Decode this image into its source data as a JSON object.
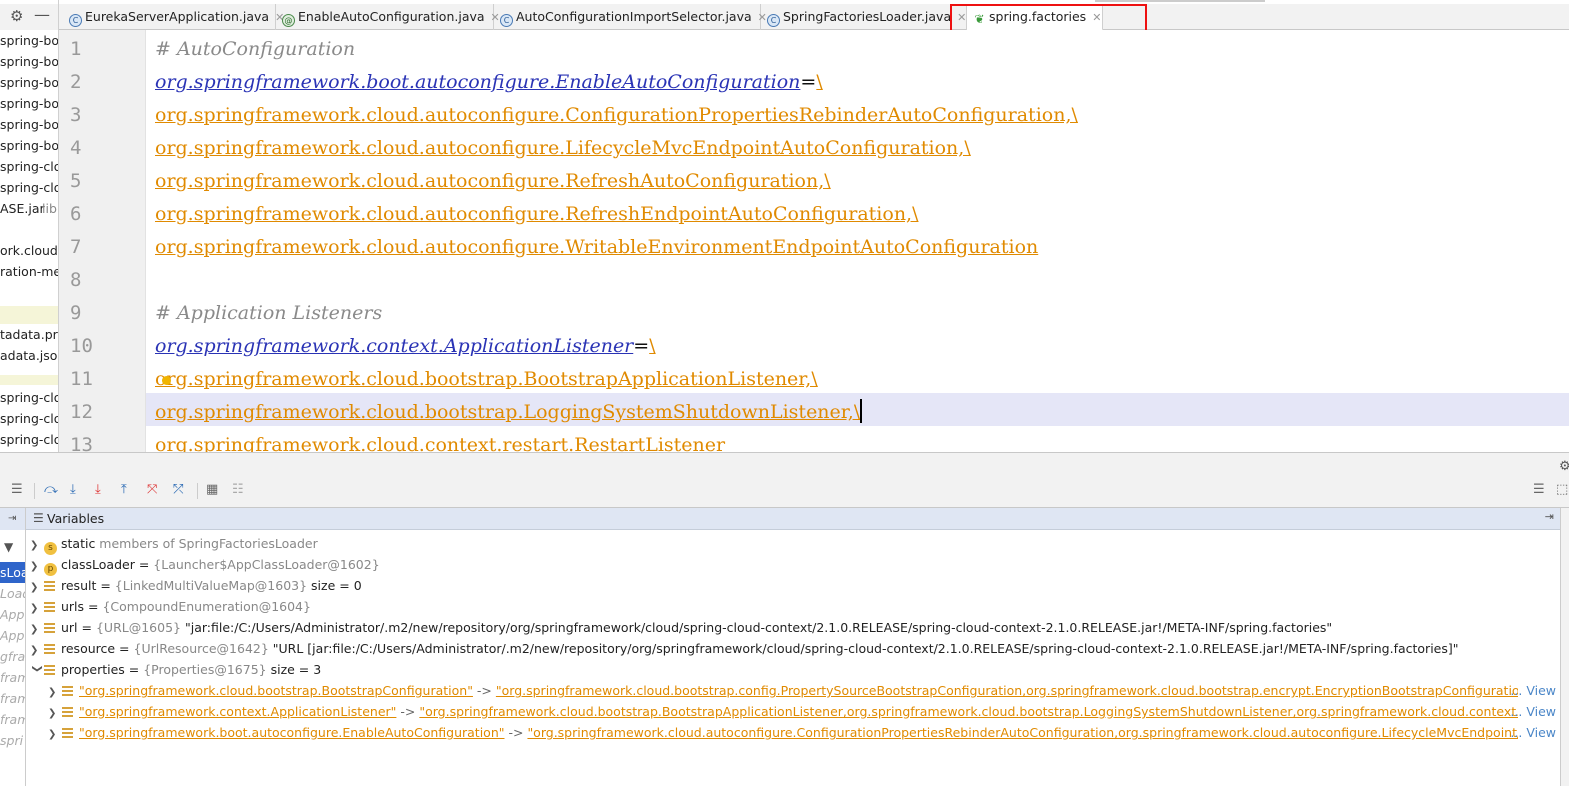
{
  "project_strip": {
    "rows": [
      {
        "text": "spring-boo",
        "gray": false
      },
      {
        "text": "spring-boo",
        "gray": false
      },
      {
        "text": "spring-boo",
        "gray": false
      },
      {
        "text": "spring-boo",
        "gray": false
      },
      {
        "text": "spring-boo",
        "gray": false
      },
      {
        "text": "spring-boo",
        "gray": false
      },
      {
        "text": "spring-clo",
        "gray": false
      },
      {
        "text": "spring-clo",
        "gray": false
      },
      {
        "text": "ASE.jar",
        "gray": false
      },
      {
        "text": "libr",
        "gray": true
      },
      {
        "text": "ork.cloud.s",
        "gray": false
      },
      {
        "text": "ration-me",
        "gray": false
      },
      {
        "text": "tadata.pro",
        "gray": false
      },
      {
        "text": "adata.json",
        "gray": false
      },
      {
        "text": "spring-clo",
        "gray": false
      },
      {
        "text": "spring-clo",
        "gray": false
      },
      {
        "text": "spring-clo",
        "gray": false
      }
    ]
  },
  "tabs": [
    {
      "label": "EurekaServerApplication.java",
      "icon": "C",
      "type": "class",
      "active": false
    },
    {
      "label": "EnableAutoConfiguration.java",
      "icon": "@",
      "type": "annotation",
      "active": false
    },
    {
      "label": "AutoConfigurationImportSelector.java",
      "icon": "C",
      "type": "class",
      "active": false
    },
    {
      "label": "SpringFactoriesLoader.java",
      "icon": "C",
      "type": "class",
      "active": false
    },
    {
      "label": "spring.factories",
      "icon": "leaf",
      "type": "properties",
      "active": true
    }
  ],
  "editor": {
    "line_numbers": [
      "1",
      "2",
      "3",
      "4",
      "5",
      "6",
      "7",
      "8",
      "9",
      "10",
      "11",
      "12",
      "13"
    ],
    "lines": {
      "l1": "# AutoConfiguration",
      "l2_key": "org.springframework.boot.autoconfigure.EnableAutoConfiguration",
      "l2_eq": "=",
      "l2_val": "\\",
      "l3": "org.springframework.cloud.autoconfigure.ConfigurationPropertiesRebinderAutoConfiguration,\\",
      "l4": "org.springframework.cloud.autoconfigure.LifecycleMvcEndpointAutoConfiguration,\\",
      "l5": "org.springframework.cloud.autoconfigure.RefreshAutoConfiguration,\\",
      "l6": "org.springframework.cloud.autoconfigure.RefreshEndpointAutoConfiguration,\\",
      "l7": "org.springframework.cloud.autoconfigure.WritableEnvironmentEndpointAutoConfiguration",
      "l9": "# Application Listeners",
      "l10_key": "org.springframework.context.ApplicationListener",
      "l10_eq": "=",
      "l10_val": "\\",
      "l11": "org.springframework.cloud.bootstrap.BootstrapApplicationListener,\\",
      "l12": "org.springframework.cloud.bootstrap.LoggingSystemShutdownListener,\\",
      "l13": "org.springframework.cloud.context.restart.RestartListener"
    }
  },
  "debugger": {
    "panel_title": "Variables",
    "frames": [
      {
        "text": "sLoa",
        "selected": true
      },
      {
        "text": "Load",
        "selected": false
      },
      {
        "text": "App",
        "selected": false
      },
      {
        "text": "App",
        "selected": false
      },
      {
        "text": "gfra",
        "selected": false
      },
      {
        "text": "fram",
        "selected": false
      },
      {
        "text": "fram",
        "selected": false
      },
      {
        "text": "fram",
        "selected": false
      },
      {
        "text": "spri",
        "selected": false
      }
    ],
    "variables": [
      {
        "badge": "s",
        "name": "static",
        "rest": " members of SpringFactoriesLoader"
      },
      {
        "badge": "p",
        "name": "classLoader",
        "rest": " = ",
        "type": "{Launcher$AppClassLoader@1602}",
        "extra": ""
      },
      {
        "badge": "f",
        "name": "result",
        "rest": " = ",
        "type": "{LinkedMultiValueMap@1603}",
        "extra": "  size = 0"
      },
      {
        "badge": "f",
        "name": "urls",
        "rest": " = ",
        "type": "{CompoundEnumeration@1604}",
        "extra": ""
      },
      {
        "badge": "f",
        "name": "url",
        "rest": " = ",
        "type": "{URL@1605}",
        "extra": " \"jar:file:/C:/Users/Administrator/.m2/new/repository/org/springframework/cloud/spring-cloud-context/2.1.0.RELEASE/spring-cloud-context-2.1.0.RELEASE.jar!/META-INF/spring.factories\""
      },
      {
        "badge": "f",
        "name": "resource",
        "rest": " = ",
        "type": "{UrlResource@1642}",
        "extra": " \"URL [jar:file:/C:/Users/Administrator/.m2/new/repository/org/springframework/cloud/spring-cloud-context/2.1.0.RELEASE/spring-cloud-context-2.1.0.RELEASE.jar!/META-INF/spring.factories]\""
      },
      {
        "badge": "f",
        "name": "properties",
        "rest": " = ",
        "type": "{Properties@1675}",
        "extra": "  size = 3"
      }
    ],
    "entries": [
      {
        "key": "\"org.springframework.cloud.bootstrap.BootstrapConfiguration\"",
        "arrow": " -> ",
        "value": "\"org.springframework.cloud.bootstrap.config.PropertySourceBootstrapConfiguration,org.springframework.cloud.bootstrap.encrypt.EncryptionBootstrapConfiguration,",
        "more": "...",
        "view": "View"
      },
      {
        "key": "\"org.springframework.context.ApplicationListener\"",
        "arrow": " -> ",
        "value": "\"org.springframework.cloud.bootstrap.BootstrapApplicationListener,org.springframework.cloud.bootstrap.LoggingSystemShutdownListener,org.springframework.cloud.context.res",
        "more": "...",
        "view": "View"
      },
      {
        "key": "\"org.springframework.boot.autoconfigure.EnableAutoConfiguration\"",
        "arrow": " -> ",
        "value": "\"org.springframework.cloud.autoconfigure.ConfigurationPropertiesRebinderAutoConfiguration,org.springframework.cloud.autoconfigure.LifecycleMvcEndpoint/",
        "more": "...",
        "view": "View"
      }
    ]
  },
  "colors": {
    "key": "#2a33b5",
    "value": "#e08a00",
    "comment": "#8a8a8a",
    "highlight_box": "#e11111",
    "selected_frame": "#2f65ca"
  }
}
